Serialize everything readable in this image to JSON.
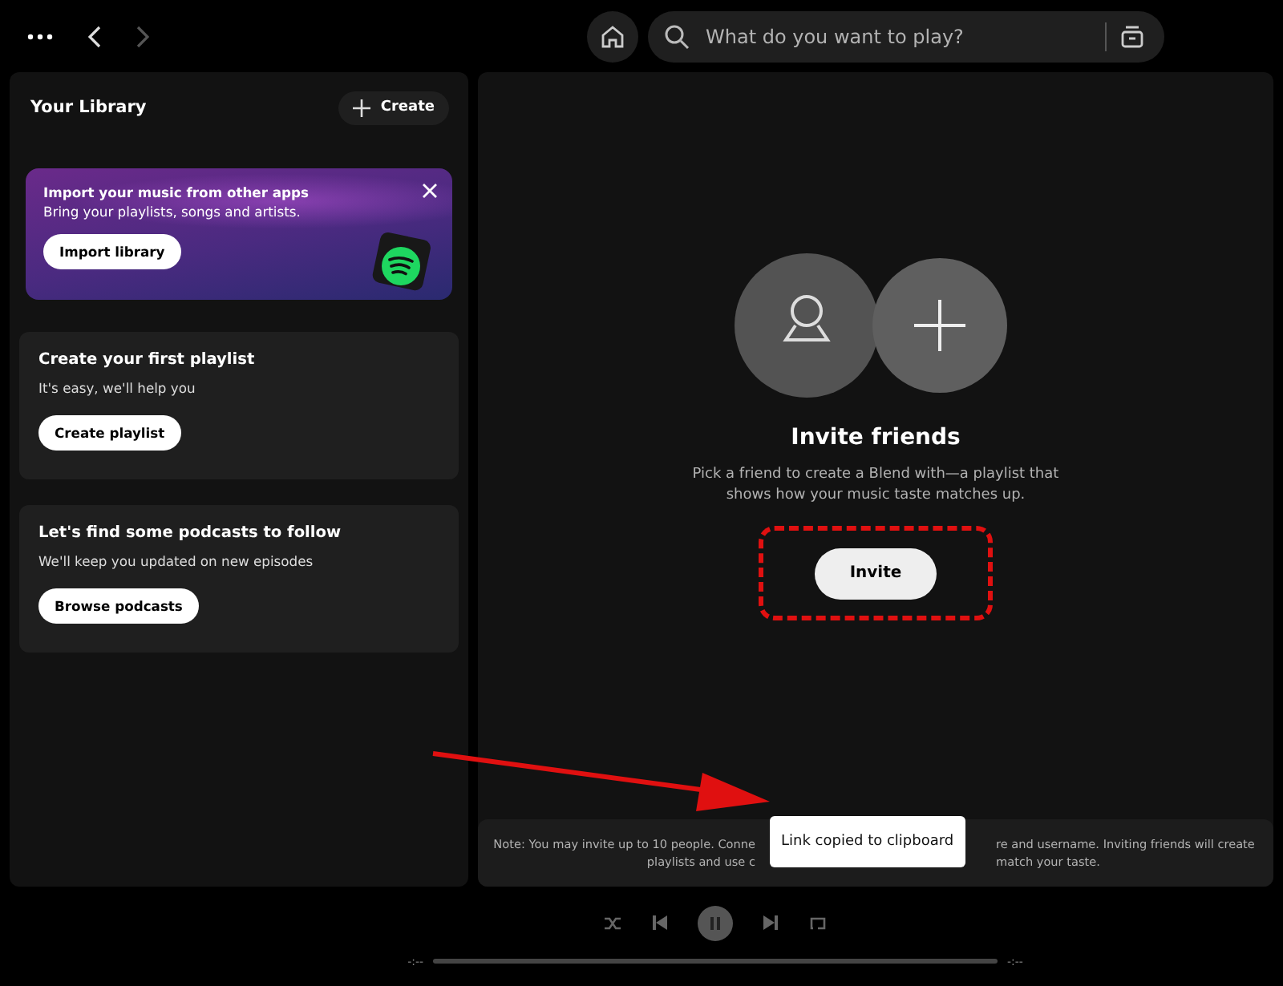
{
  "topbar": {
    "search": {
      "placeholder": "What do you want to play?"
    }
  },
  "library": {
    "title": "Your Library",
    "create_label": "Create",
    "import_card": {
      "title": "Import your music from other apps",
      "subtitle": "Bring your playlists, songs and artists.",
      "button": "Import library"
    },
    "cards": [
      {
        "title": "Create your first playlist",
        "subtitle": "It's easy, we'll help you",
        "button": "Create playlist"
      },
      {
        "title": "Let's find some podcasts to follow",
        "subtitle": "We'll keep you updated on new episodes",
        "button": "Browse podcasts"
      }
    ]
  },
  "main": {
    "heading": "Invite friends",
    "description": "Pick a friend to create a Blend with—a playlist that shows how your music taste matches up.",
    "button": "Invite",
    "note_lines": [
      {
        "left": "Note: You may invite up to 10 people. Conne",
        "right": "re and username. Inviting friends will create"
      },
      {
        "left": "playlists and use c",
        "right": "match your taste."
      }
    ],
    "toast": "Link copied to clipboard"
  },
  "player": {
    "elapsed": "-:--",
    "duration": "-:--",
    "level": 0
  }
}
